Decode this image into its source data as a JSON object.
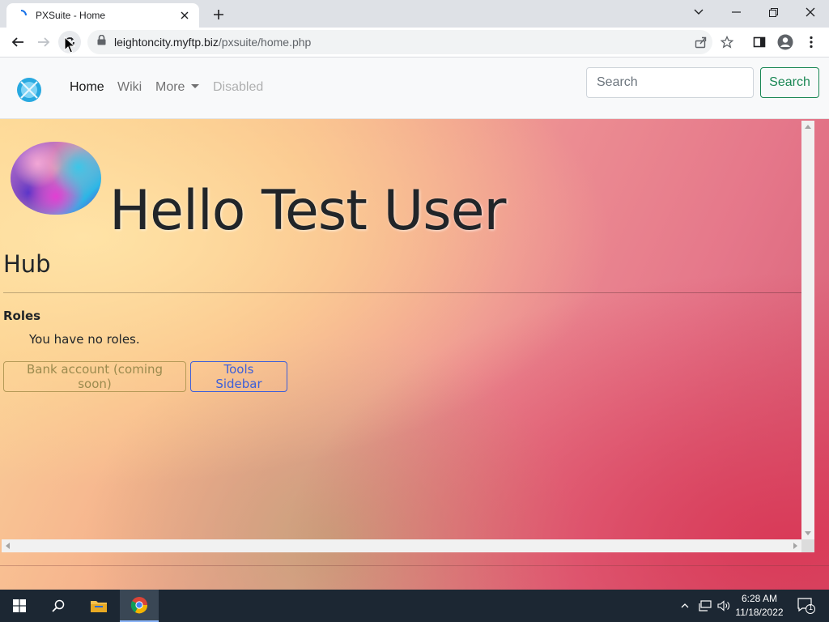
{
  "browser": {
    "tab_title": "PXSuite - Home",
    "url_host": "leightoncity.myftp.biz",
    "url_path": "/pxsuite/home.php"
  },
  "navbar": {
    "links": [
      "Home",
      "Wiki",
      "More",
      "Disabled"
    ],
    "search_placeholder": "Search",
    "search_button": "Search"
  },
  "page": {
    "greeting": "Hello Test User",
    "section_title": "Hub",
    "roles_heading": "Roles",
    "roles_empty": "You have no roles.",
    "buttons": {
      "bank": "Bank account (coming soon)",
      "tools": "Tools Sidebar"
    }
  },
  "taskbar": {
    "time": "6:28 AM",
    "date": "11/18/2022",
    "notification_count": "1"
  },
  "colors": {
    "success": "#198754",
    "primary": "#3d5fd9",
    "warning_muted": "#9b8a4e"
  }
}
